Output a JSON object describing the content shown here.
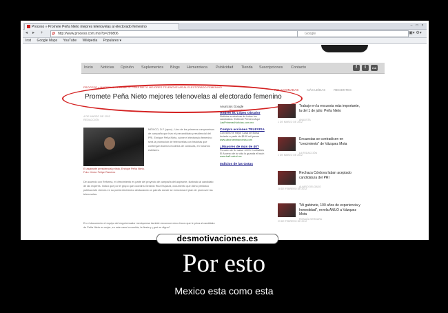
{
  "browser": {
    "tab_title": "Proceso » Promete Peña Nieto mejores telenovelas al electorado femenino",
    "window_buttons": [
      "–",
      "□",
      "×"
    ],
    "nav_buttons": [
      "◂",
      "▸",
      "+"
    ],
    "url": "http://www.proceso.com.mx/?p=299806",
    "search_placeholder": "Google",
    "bookmarks": [
      "Inst",
      "Google Maps",
      "YouTube",
      "Wikipedia",
      "Populares ▾"
    ],
    "right_icons": "▣▾ ⚙▾"
  },
  "site": {
    "nav": [
      "Inicio",
      "Noticias",
      "Opinión",
      "Suplementos",
      "Blogs",
      "Hemeroteca",
      "Publicidad",
      "Tienda",
      "Suscripciones",
      "Contacto"
    ],
    "social": [
      "f",
      "t",
      "rss"
    ],
    "breadcrumb": "PROCESO » NACIONAL » PROMETE PEÑA NIETO MEJORES TELENOVELAS AL ELECTORADO FEMENINO",
    "headline": "Promete Peña Nieto mejores telenovelas al electorado femenino",
    "side_tabs": [
      "RELACIONADAS",
      "MÁS LEÍDAS",
      "RECIENTES"
    ],
    "date_line": "4 DE MARZO DE 2012",
    "author": "REDACCIÓN",
    "recommend": "Recomendar",
    "photo_caption": "El aspirante presidencial priísta, Enrique Peña Nieto. Foto: Víctor Felipe Ramírez",
    "body_intro": "MÉXICO, D.F. (apro).- Uno de los primeros compromisos de campaña que hizo el precandidato presidencial del PRI, Enrique Peña Nieto, sobre el electorado femenino será la promoción de telenovelas con historias que contengan buenos modelos de conducta, en horarios estelares.",
    "body_more": "De acuerdo con Reforma, el ofrecimiento es parte del proyecto de campaña del aspirante, ilustrado al candidato de las mujeres. Indicó que por el grupo que coordina Gerardo Ruiz Esparza, documento que dicho periódico publica este viernes en su portal electrónico destacando un párrafo donde se menciona el plan de promover las telenovelas.",
    "body_end": "En el documento el equipo del exgobernador mexiquense también reconoce cinco focos que le priva al candidato de Peña Nieto es mujer, en este caso la comida, la fiesta y ¿qué es digno?",
    "ads_label": "Anuncios Google",
    "ads": [
      {
        "title": "Andrés M. López Obrador",
        "text": "Noticias exclusivas de todos los candidatos. Entérate Primero Aquí",
        "url": "LasPrimerasNoticias.com.mx"
      },
      {
        "title": "Compra acciones TELEVISA",
        "text": "Con 5000 te mejor Casa de Bolsa Invierte a partir de $100 mil pesos",
        "url": "www.aboruentnanomia.com"
      },
      {
        "title": "¿Mayores de más de 40?",
        "text": "Pensión de 5x salud 100% Confiables El Acceso de tu vida lo guarda el bach",
        "url": "www.ba5.salud.mx"
      },
      {
        "title": "Indicios de las Gotas",
        "text": "",
        "url": ""
      }
    ],
    "side_items": [
      {
        "title": "Trabajo en la encuesta más importante, la del 1 de julio: Peña Nieto",
        "byline": "ANALISTA",
        "date": "1 DE MARZO DE 2012"
      },
      {
        "title": "Encuestas se contradicen en \"crecimiento\" de Vázquez Mota",
        "byline": "LA REDACCIÓN",
        "date": "1 DE MARZO DE 2012"
      },
      {
        "title": "Rechaza Córdova Iaban aceptado candidatura del PRI",
        "byline": "ALVARO DELGADO",
        "date": "28 DE FEBRERO DE 2012"
      },
      {
        "title": "\"Mi gabinete, 100 años de experiencia y honestidad\", revela AMLO a Vázquez Mota",
        "byline": "ROSALÍA VERGARA",
        "date": "29 DE FEBRERO DE 2012"
      }
    ]
  },
  "poster": {
    "watermark": "desmotivaciones.es",
    "heading": "Por esto",
    "caption": "Mexico esta como esta"
  }
}
